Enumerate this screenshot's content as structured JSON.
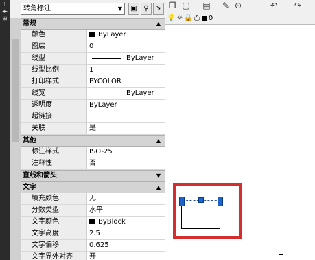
{
  "leftbar_glyphs": [
    "↑",
    "◂▸",
    "⊞"
  ],
  "palette": {
    "object_type": "转角标注",
    "toolbar_icons": [
      "select-objects-icon",
      "quick-select-icon",
      "pickadd-icon"
    ]
  },
  "sections": [
    {
      "title": "常规",
      "collapsed": false,
      "rows": [
        {
          "key": "颜色",
          "value": "ByLayer",
          "swatch": "#000000"
        },
        {
          "key": "图层",
          "value": "0"
        },
        {
          "key": "线型",
          "value": "ByLayer",
          "line": true
        },
        {
          "key": "线型比例",
          "value": "1"
        },
        {
          "key": "打印样式",
          "value": "BYCOLOR"
        },
        {
          "key": "线宽",
          "value": "ByLayer",
          "line": true
        },
        {
          "key": "透明度",
          "value": "ByLayer"
        },
        {
          "key": "超链接",
          "value": ""
        },
        {
          "key": "关联",
          "value": "是"
        }
      ]
    },
    {
      "title": "其他",
      "collapsed": false,
      "rows": [
        {
          "key": "标注样式",
          "value": "ISO-25"
        },
        {
          "key": "注释性",
          "value": "否"
        }
      ]
    },
    {
      "title": "直线和箭头",
      "collapsed": true,
      "rows": []
    },
    {
      "title": "文字",
      "collapsed": false,
      "rows": [
        {
          "key": "填充颜色",
          "value": "无"
        },
        {
          "key": "分数类型",
          "value": "水平"
        },
        {
          "key": "文字颜色",
          "value": "ByBlock",
          "swatch": "#000000"
        },
        {
          "key": "文字高度",
          "value": "2.5"
        },
        {
          "key": "文字偏移",
          "value": "0.625"
        },
        {
          "key": "文字界外对齐",
          "value": "开"
        }
      ]
    }
  ],
  "drawing": {
    "toolbar_icons": [
      "copy-icon",
      "paste-icon",
      "clipboard-icon",
      "match-properties-icon",
      "measure-icon",
      "undo-icon",
      "redo-icon"
    ],
    "layer_name": "0",
    "layer_icons": [
      "bulb-icon",
      "sun-icon",
      "lock-icon",
      "print-icon"
    ]
  }
}
